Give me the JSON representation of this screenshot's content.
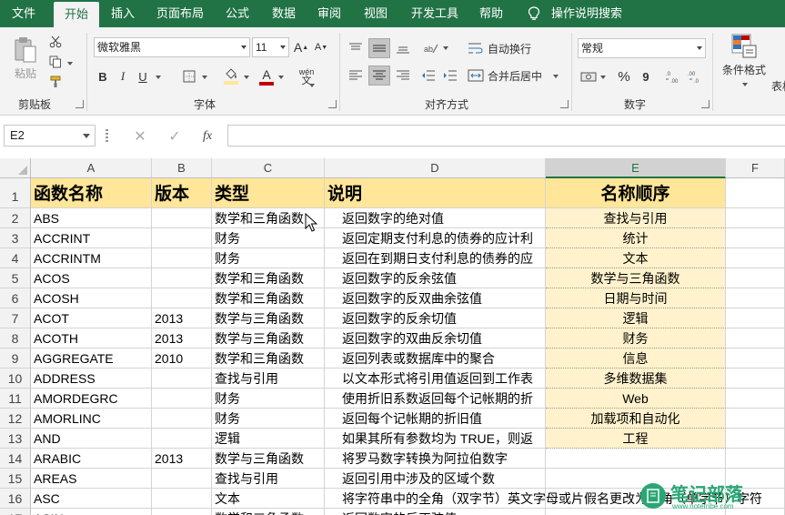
{
  "tabs": [
    "文件",
    "开始",
    "插入",
    "页面布局",
    "公式",
    "数据",
    "审阅",
    "视图",
    "开发工具",
    "帮助"
  ],
  "active_tab": "开始",
  "tell_me": "操作说明搜索",
  "ribbon": {
    "clipboard": {
      "paste": "粘贴",
      "label": "剪贴板"
    },
    "font": {
      "name": "微软雅黑",
      "size": "11",
      "label": "字体",
      "bold": "B",
      "italic": "I",
      "underline": "U",
      "grow": "A",
      "shrink": "A",
      "phonetic": "wén"
    },
    "alignment": {
      "wrap": "自动换行",
      "merge": "合并后居中",
      "label": "对齐方式"
    },
    "number": {
      "format": "常规",
      "label": "数字",
      "percent": "%",
      "comma": "9"
    },
    "styles": {
      "conditional": "条件格式",
      "table_partial": "表格"
    }
  },
  "formula_bar": {
    "name_box": "E2",
    "fx": "fx",
    "formula": ""
  },
  "grid": {
    "columns": [
      "A",
      "B",
      "C",
      "D",
      "E",
      "F"
    ],
    "selected_column": "E",
    "rows": [
      {
        "num": "1",
        "a": "函数名称",
        "b": "版本",
        "c": "类型",
        "d": "说明",
        "e": "名称顺序"
      },
      {
        "num": "2",
        "a": "ABS",
        "b": "",
        "c": "数学和三角函数",
        "d": "返回数字的绝对值",
        "e": "查找与引用"
      },
      {
        "num": "3",
        "a": "ACCRINT",
        "b": "",
        "c": "财务",
        "d": "返回定期支付利息的债券的应计利",
        "e": "统计"
      },
      {
        "num": "4",
        "a": "ACCRINTM",
        "b": "",
        "c": "财务",
        "d": "返回在到期日支付利息的债券的应",
        "e": "文本"
      },
      {
        "num": "5",
        "a": "ACOS",
        "b": "",
        "c": "数学和三角函数",
        "d": "返回数字的反余弦值",
        "e": "数学与三角函数"
      },
      {
        "num": "6",
        "a": "ACOSH",
        "b": "",
        "c": "数学和三角函数",
        "d": "返回数字的反双曲余弦值",
        "e": "日期与时间"
      },
      {
        "num": "7",
        "a": "ACOT",
        "b": "2013",
        "c": "数学与三角函数",
        "d": "返回数字的反余切值",
        "e": "逻辑"
      },
      {
        "num": "8",
        "a": "ACOTH",
        "b": "2013",
        "c": "数学与三角函数",
        "d": "返回数字的双曲反余切值",
        "e": "财务"
      },
      {
        "num": "9",
        "a": "AGGREGATE",
        "b": "2010",
        "c": "数学和三角函数",
        "d": "返回列表或数据库中的聚合",
        "e": "信息"
      },
      {
        "num": "10",
        "a": "ADDRESS",
        "b": "",
        "c": "查找与引用",
        "d": "以文本形式将引用值返回到工作表",
        "e": "多维数据集"
      },
      {
        "num": "11",
        "a": "AMORDEGRC",
        "b": "",
        "c": "财务",
        "d": "使用折旧系数返回每个记帐期的折",
        "e": "Web"
      },
      {
        "num": "12",
        "a": "AMORLINC",
        "b": "",
        "c": "财务",
        "d": "返回每个记帐期的折旧值",
        "e": "加载项和自动化"
      },
      {
        "num": "13",
        "a": "AND",
        "b": "",
        "c": "逻辑",
        "d": "如果其所有参数均为 TRUE，则返",
        "e": "工程"
      },
      {
        "num": "14",
        "a": "ARABIC",
        "b": "2013",
        "c": "数学与三角函数",
        "d": "将罗马数字转换为阿拉伯数字",
        "e": ""
      },
      {
        "num": "15",
        "a": "AREAS",
        "b": "",
        "c": "查找与引用",
        "d": "返回引用中涉及的区域个数",
        "e": ""
      },
      {
        "num": "16",
        "a": "ASC",
        "b": "",
        "c": "文本",
        "d": "将字符串中的全角（双字节）英文字母或片假名更改为半角（单字节）字符",
        "e": ""
      },
      {
        "num": "17",
        "a": "ASIN",
        "b": "",
        "c": "数学和三角函数",
        "d": "返回数字的反正弦值",
        "e": ""
      }
    ]
  },
  "watermark": {
    "text": "笔记部落",
    "url": "www.notetribe.com"
  },
  "colors": {
    "brand": "#217346",
    "header_fill": "#ffe699",
    "column_e_fill": "#fff2cc"
  }
}
